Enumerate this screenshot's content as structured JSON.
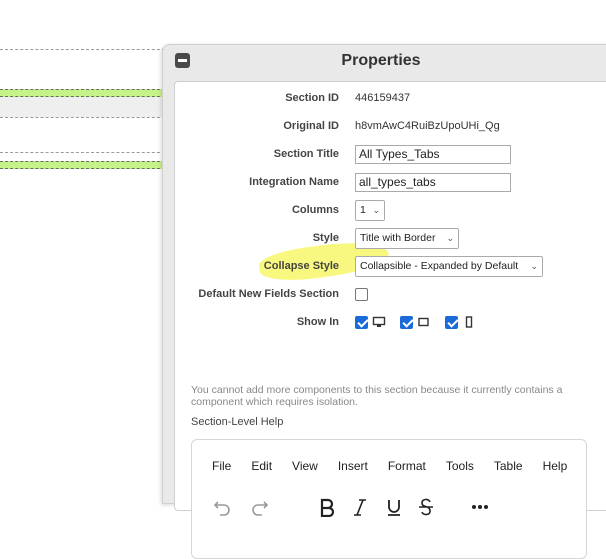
{
  "panel": {
    "title": "Properties"
  },
  "fields": {
    "section_id": {
      "label": "Section ID",
      "value": "446159437"
    },
    "original_id": {
      "label": "Original ID",
      "value": "h8vmAwC4RuiBzUpoUHi_Qg"
    },
    "section_title": {
      "label": "Section Title",
      "value": "All Types_Tabs"
    },
    "integration_name": {
      "label": "Integration Name",
      "value": "all_types_tabs"
    },
    "columns": {
      "label": "Columns",
      "value": "1"
    },
    "style": {
      "label": "Style",
      "value": "Title with Border"
    },
    "collapse_style": {
      "label": "Collapse Style",
      "value": "Collapsible - Expanded by Default"
    },
    "default_new_fields": {
      "label": "Default New Fields Section",
      "checked": false
    },
    "show_in": {
      "label": "Show In",
      "desktop": true,
      "tablet": true,
      "mobile": true
    }
  },
  "warning_text": "You cannot add more components to this section because it currently contains a component which requires isolation.",
  "help_label": "Section-Level Help",
  "editor": {
    "menu": [
      "File",
      "Edit",
      "View",
      "Insert",
      "Format",
      "Tools",
      "Table",
      "Help"
    ]
  },
  "icons": [
    "collapse-icon",
    "desktop-icon",
    "tablet-icon",
    "mobile-icon",
    "undo-icon",
    "redo-icon",
    "bold-icon",
    "italic-icon",
    "underline-icon",
    "strikethrough-icon",
    "more-icon"
  ],
  "colors": {
    "accent": "#1a6ad8",
    "highlight": "#f7f76a",
    "green": "#c6f28a"
  }
}
